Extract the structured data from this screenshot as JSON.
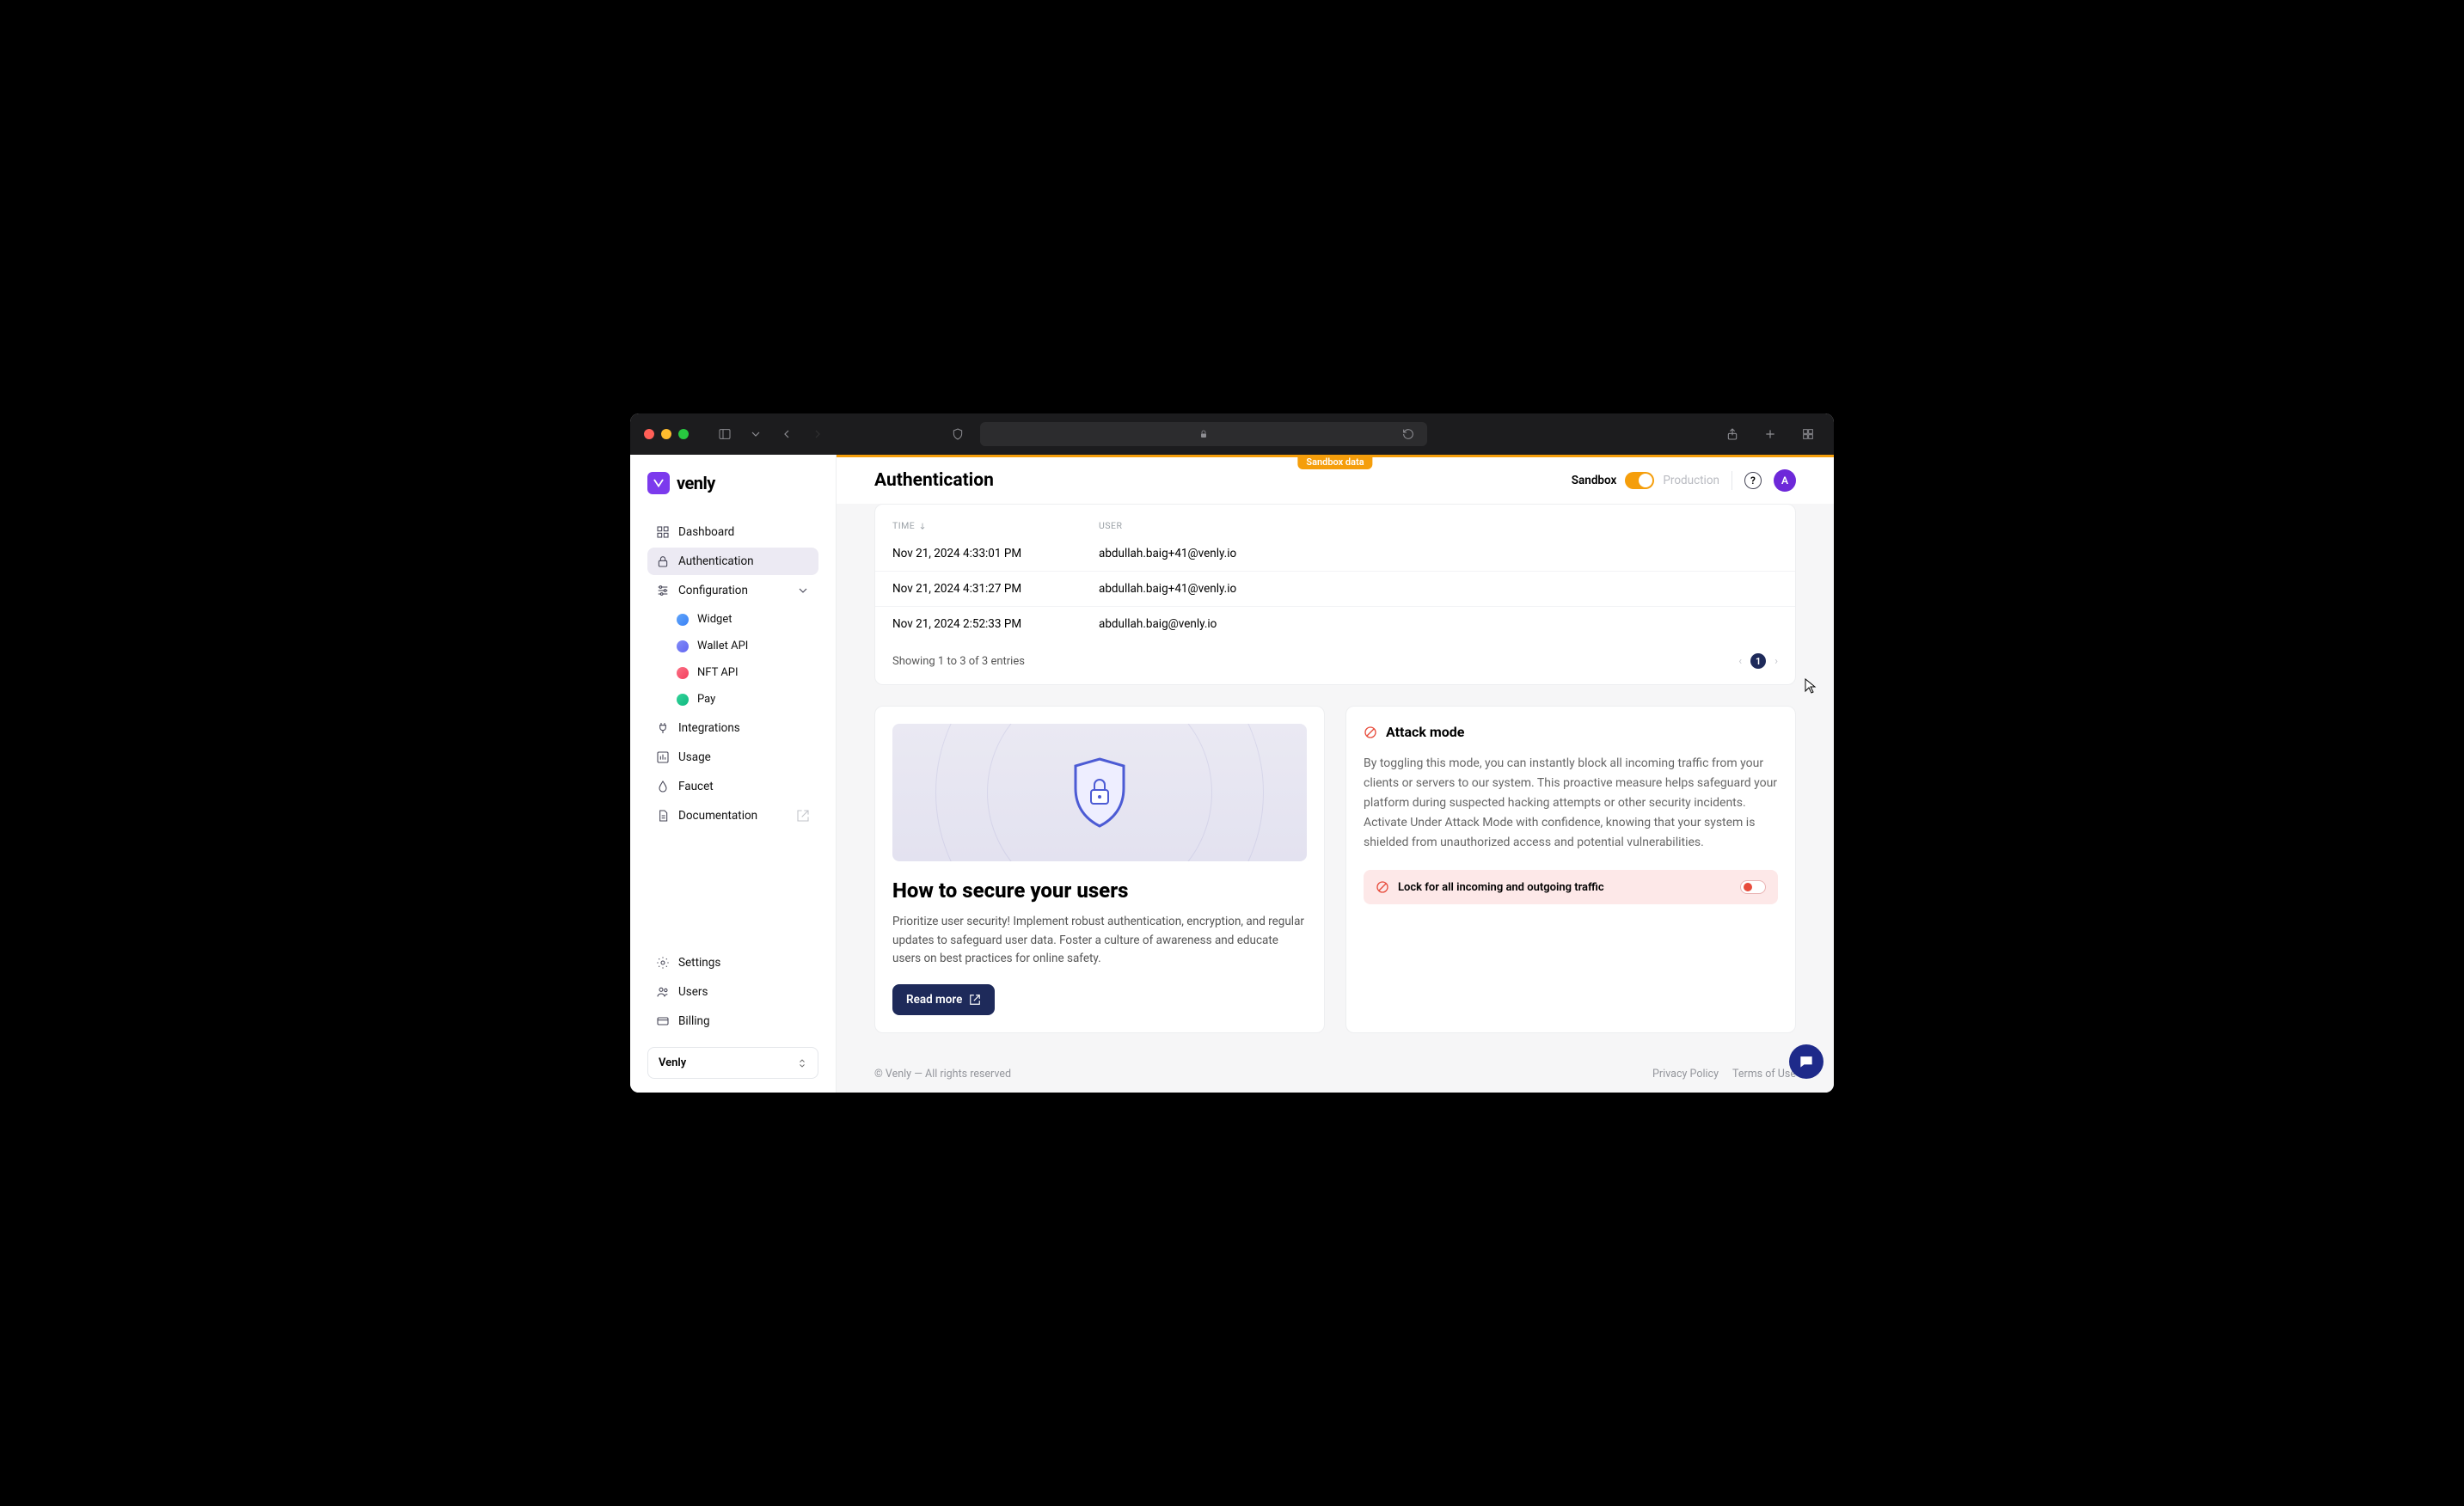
{
  "sandbox_banner": "Sandbox data",
  "header": {
    "title": "Authentication",
    "sandbox_label": "Sandbox",
    "production_label": "Production",
    "avatar_initial": "A"
  },
  "logo": {
    "text": "venly"
  },
  "sidebar": {
    "items": [
      {
        "label": "Dashboard"
      },
      {
        "label": "Authentication"
      },
      {
        "label": "Configuration"
      },
      {
        "label": "Integrations"
      },
      {
        "label": "Usage"
      },
      {
        "label": "Faucet"
      },
      {
        "label": "Documentation"
      }
    ],
    "config_children": [
      {
        "label": "Widget",
        "color": "#3b82f6"
      },
      {
        "label": "Wallet API",
        "color": "#6366f1"
      },
      {
        "label": "NFT API",
        "color": "#f43f5e"
      },
      {
        "label": "Pay",
        "color": "#10b981"
      }
    ],
    "bottom": [
      {
        "label": "Settings"
      },
      {
        "label": "Users"
      },
      {
        "label": "Billing"
      }
    ],
    "org": "Venly"
  },
  "table": {
    "columns": {
      "time": "TIME",
      "user": "USER"
    },
    "rows": [
      {
        "time": "Nov 21, 2024 4:33:01 PM",
        "user": "abdullah.baig+41@venly.io"
      },
      {
        "time": "Nov 21, 2024 4:31:27 PM",
        "user": "abdullah.baig+41@venly.io"
      },
      {
        "time": "Nov 21, 2024 2:52:33 PM",
        "user": "abdullah.baig@venly.io"
      }
    ],
    "info": "Showing 1 to 3 of 3 entries",
    "page": "1"
  },
  "info_card": {
    "title": "How to secure your users",
    "body": "Prioritize user security! Implement robust authentication, encryption, and regular updates to safeguard user data. Foster a culture of awareness and educate users on best practices for online safety.",
    "button": "Read more"
  },
  "attack_card": {
    "title": "Attack mode",
    "body": "By toggling this mode, you can instantly block all incoming traffic from your clients or servers to our system. This proactive measure helps safeguard your platform during suspected hacking attempts or other security incidents. Activate Under Attack Mode with confidence, knowing that your system is shielded from unauthorized access and potential vulnerabilities.",
    "lock_label": "Lock for all incoming and outgoing traffic"
  },
  "footer": {
    "copyright": "© Venly — All rights reserved",
    "privacy": "Privacy Policy",
    "terms": "Terms of Use"
  }
}
